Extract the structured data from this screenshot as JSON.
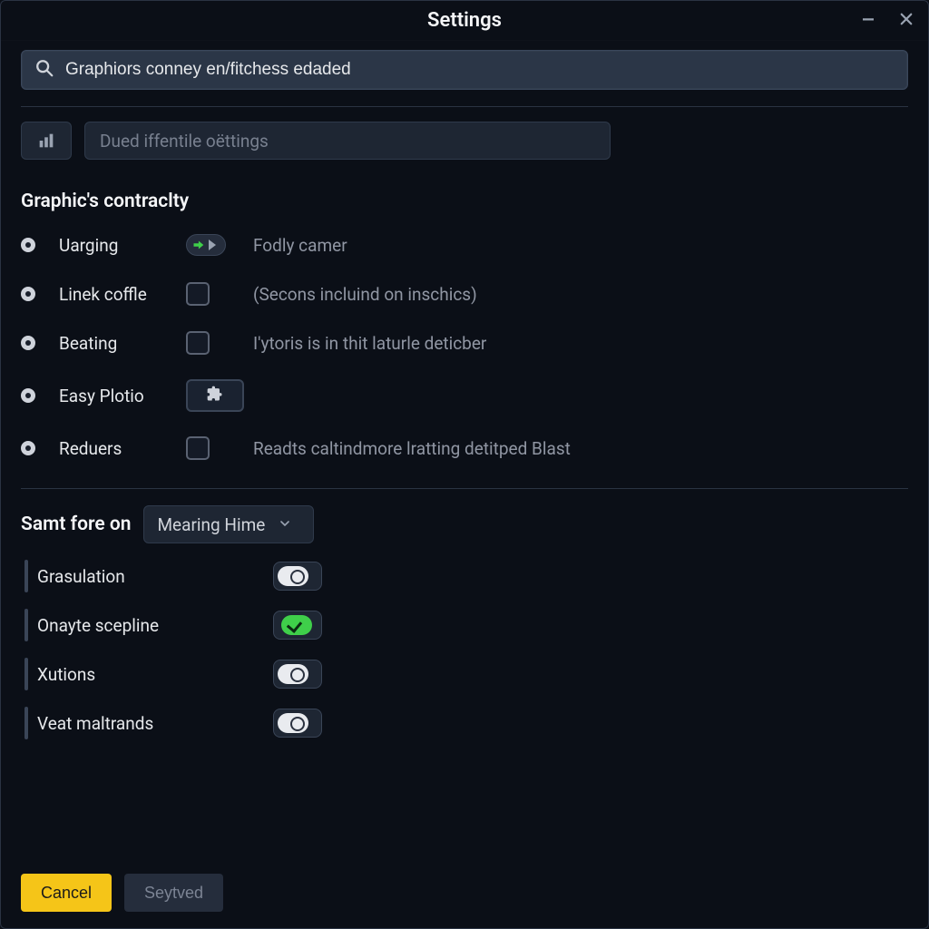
{
  "window": {
    "title": "Settings"
  },
  "search": {
    "value": "Graphiors conney en/fitchess edaded"
  },
  "profile": {
    "placeholder": "Dued iffentile oëttings"
  },
  "section1": {
    "title": "Graphic's contraclty",
    "rows": [
      {
        "label": "Uarging",
        "desc": "Fodly camer",
        "ctrl": "toggle-arrow"
      },
      {
        "label": "Linek coffle",
        "desc": "(Secons incluind on inschics)",
        "ctrl": "checkbox"
      },
      {
        "label": "Beating",
        "desc": "I'ytoris is in thit laturle deticber",
        "ctrl": "checkbox"
      },
      {
        "label": "Easy Plotio",
        "desc": "",
        "ctrl": "puzzle"
      },
      {
        "label": "Reduers",
        "desc": "Readts caltindmore lratting detitped Blast",
        "ctrl": "checkbox"
      }
    ]
  },
  "section2": {
    "label": "Samt fore on",
    "select_value": "Mearing Hime",
    "toggles": [
      {
        "label": "Grasulation",
        "on": false
      },
      {
        "label": "Onayte scepline",
        "on": true
      },
      {
        "label": "Xutions",
        "on": false
      },
      {
        "label": "Veat maltrands",
        "on": false
      }
    ]
  },
  "footer": {
    "cancel": "Cancel",
    "save": "Seytved"
  }
}
